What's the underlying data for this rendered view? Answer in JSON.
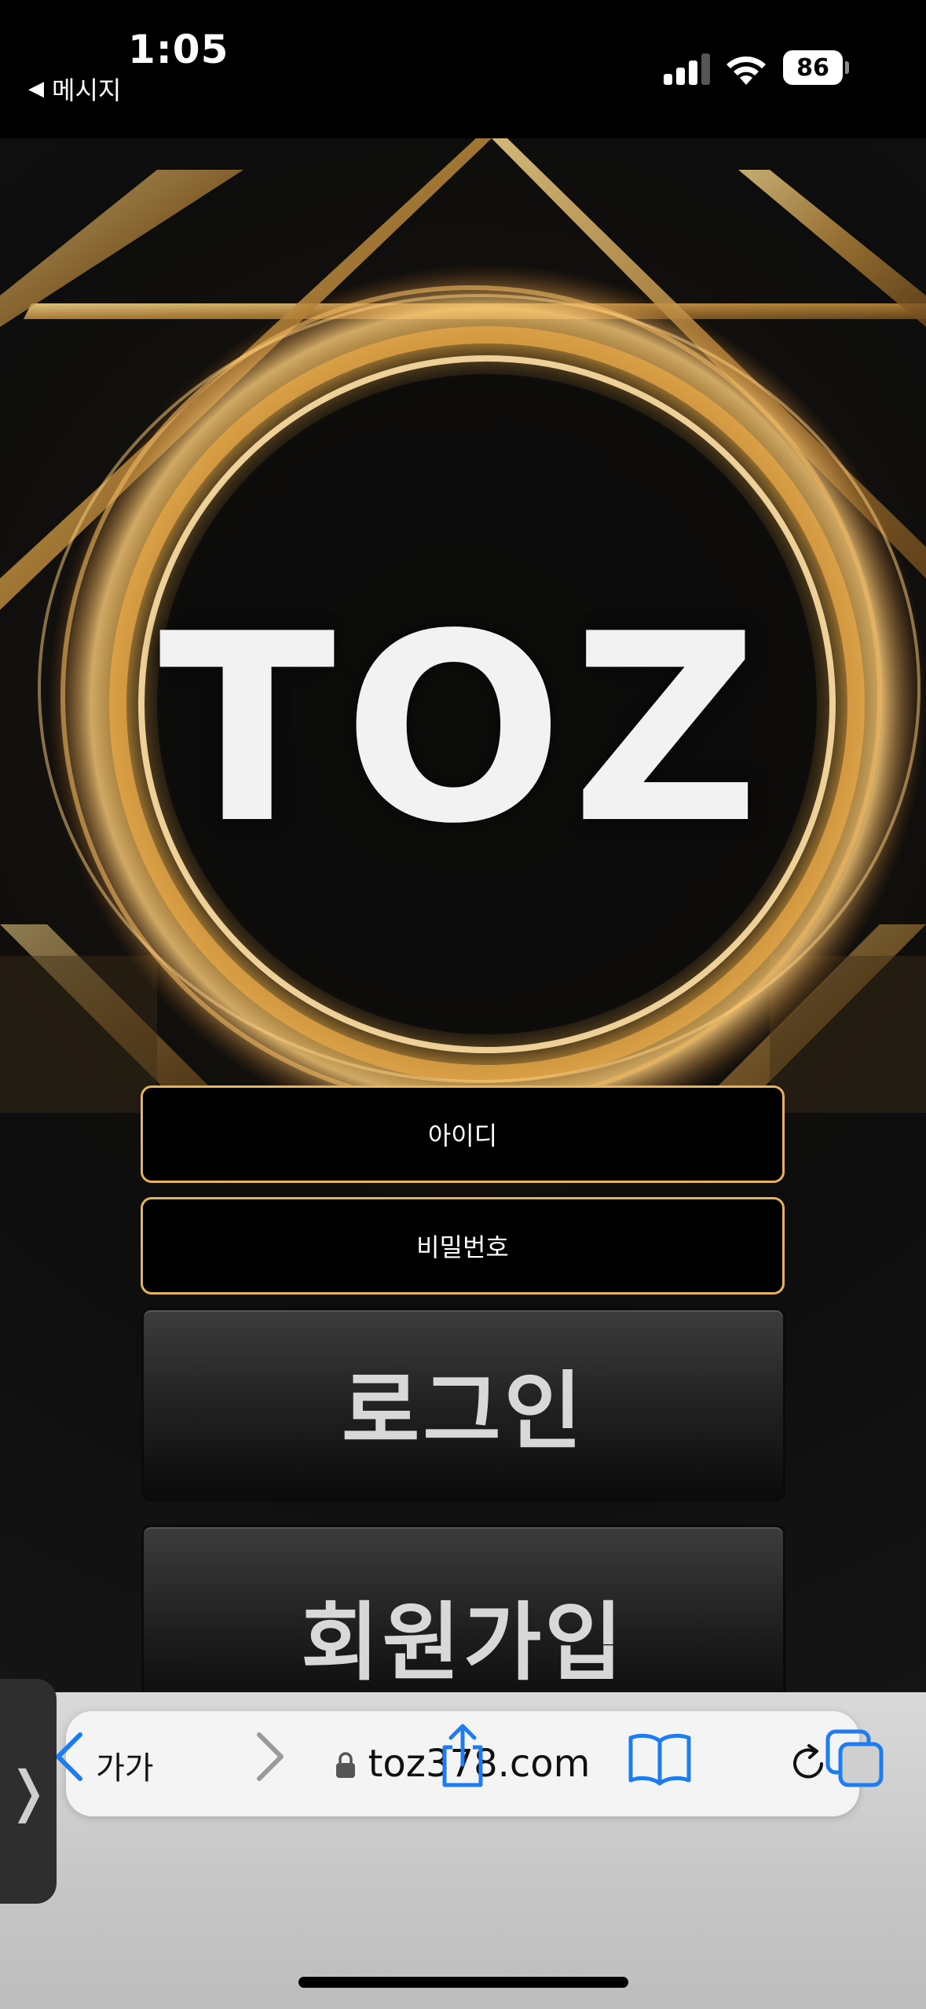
{
  "status_bar": {
    "time": "1:05",
    "back_label": "메시지",
    "battery_percent": "86"
  },
  "hero": {
    "logo_text": "TOZ"
  },
  "login_form": {
    "id_placeholder": "아이디",
    "password_placeholder": "비밀번호",
    "login_label": "로그인",
    "signup_label": "회원가입"
  },
  "browser": {
    "text_size_label": "가가",
    "url": "toz378.com",
    "side_tab_glyph": "❭"
  },
  "colors": {
    "accent_gold": "#e6b35a",
    "safari_blue": "#1f7cf0"
  }
}
